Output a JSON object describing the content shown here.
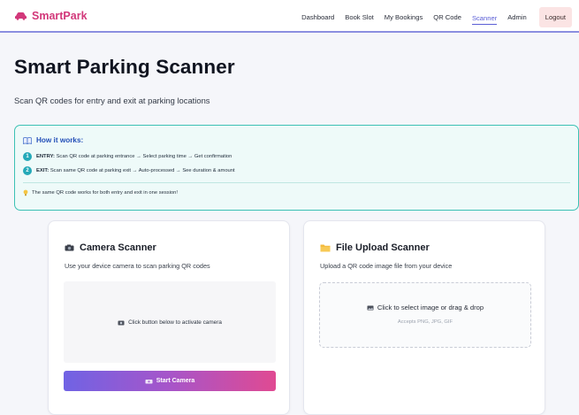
{
  "nav": {
    "brand": "SmartPark",
    "links": [
      "Dashboard",
      "Book Slot",
      "My Bookings",
      "QR Code",
      "Scanner",
      "Admin"
    ],
    "active_link": "Scanner",
    "logout_label": "Logout"
  },
  "header": {
    "title": "Smart Parking Scanner",
    "subtitle": "Scan QR codes for entry and exit at parking locations"
  },
  "how_it_works": {
    "title": "How it works:",
    "steps": [
      {
        "num": "1",
        "label": "ENTRY:",
        "text": "Scan QR code at parking entrance → Select parking time → Get confirmation"
      },
      {
        "num": "2",
        "label": "EXIT:",
        "text": "Scan same QR code at parking exit → Auto-processed → See duration & amount"
      }
    ],
    "tip": "The same QR code works for both entry and exit in one session!"
  },
  "camera_card": {
    "title": "Camera Scanner",
    "description": "Use your device camera to scan parking QR codes",
    "hint": "Click button below to activate camera",
    "button_label": "Start Camera"
  },
  "upload_card": {
    "title": "File Upload Scanner",
    "description": "Upload a QR code image file from your device",
    "dropzone_text": "Click to select image or drag & drop",
    "accepts": "Accepts PNG, JPG, GIF"
  },
  "colors": {
    "brand": "#d2387a",
    "accent": "#5b5fd6",
    "info_border": "#3cc1b4",
    "button_gradient_start": "#7063e4",
    "button_gradient_end": "#e04a92"
  }
}
